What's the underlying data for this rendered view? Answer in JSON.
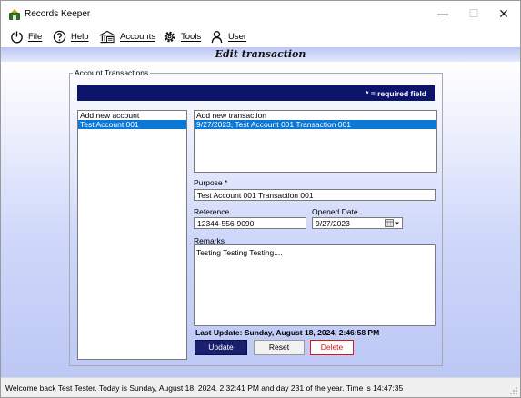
{
  "window": {
    "title": "Records Keeper",
    "icon": "records-keeper-icon"
  },
  "menu": [
    {
      "label": "File",
      "icon": "power-icon"
    },
    {
      "label": "Help",
      "icon": "question-icon"
    },
    {
      "label": "Accounts",
      "icon": "accounts-icon"
    },
    {
      "label": "Tools",
      "icon": "gear-icon"
    },
    {
      "label": "User",
      "icon": "user-icon"
    }
  ],
  "header": {
    "title": "Edit transaction"
  },
  "group": {
    "title": "Account Transactions",
    "required_note": "* = required field"
  },
  "accounts_list": {
    "items": [
      "Add new account",
      "Test Account 001"
    ],
    "selected_index": 1
  },
  "transactions_list": {
    "items": [
      "Add new transaction",
      "9/27/2023, Test Account 001 Transaction 001"
    ],
    "selected_index": 1
  },
  "form": {
    "purpose_label": "Purpose *",
    "purpose_value": "Test Account 001 Transaction 001",
    "reference_label": "Reference",
    "reference_value": "12344-556-9090",
    "opened_date_label": "Opened Date",
    "opened_date_value": "9/27/2023",
    "remarks_label": "Remarks",
    "remarks_value": "Testing Testing Testing...."
  },
  "last_update": "Last Update: Sunday, August 18, 2024, 2:46:58 PM",
  "buttons": {
    "update": "Update",
    "reset": "Reset",
    "delete": "Delete"
  },
  "status": {
    "text": "Welcome back Test Tester.   Today is Sunday, August 18, 2024. 2:32:41 PM and day 231 of the year.   Time is 14:47:35"
  },
  "colors": {
    "accent_bar": "#0b136b",
    "selection": "#0a78d7",
    "update_button": "#1a1f6e",
    "delete_text": "#d31a1a",
    "header_band": "#bcc6f4"
  }
}
